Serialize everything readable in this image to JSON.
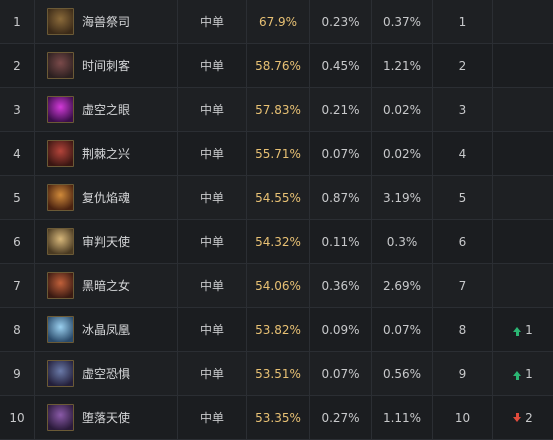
{
  "rows": [
    {
      "rank": "1",
      "hero": "海兽祭司",
      "position": "中单",
      "win_rate": "67.9%",
      "pick_rate": "0.23%",
      "ban_rate": "0.37%",
      "tier": "1",
      "trend": null,
      "avatar_color": [
        "#8a6a3a",
        "#3b2a18"
      ]
    },
    {
      "rank": "2",
      "hero": "时间刺客",
      "position": "中单",
      "win_rate": "58.76%",
      "pick_rate": "0.45%",
      "ban_rate": "1.21%",
      "tier": "2",
      "trend": null,
      "avatar_color": [
        "#7a4a4a",
        "#2c2020"
      ]
    },
    {
      "rank": "3",
      "hero": "虚空之眼",
      "position": "中单",
      "win_rate": "57.83%",
      "pick_rate": "0.21%",
      "ban_rate": "0.02%",
      "tier": "3",
      "trend": null,
      "avatar_color": [
        "#d23ad8",
        "#3a0e4a"
      ]
    },
    {
      "rank": "4",
      "hero": "荆棘之兴",
      "position": "中单",
      "win_rate": "55.71%",
      "pick_rate": "0.07%",
      "ban_rate": "0.02%",
      "tier": "4",
      "trend": null,
      "avatar_color": [
        "#b3443a",
        "#3a1612"
      ]
    },
    {
      "rank": "5",
      "hero": "复仇焰魂",
      "position": "中单",
      "win_rate": "54.55%",
      "pick_rate": "0.87%",
      "ban_rate": "3.19%",
      "tier": "5",
      "trend": null,
      "avatar_color": [
        "#d08a3a",
        "#4a2210"
      ]
    },
    {
      "rank": "6",
      "hero": "审判天使",
      "position": "中单",
      "win_rate": "54.32%",
      "pick_rate": "0.11%",
      "ban_rate": "0.3%",
      "tier": "6",
      "trend": null,
      "avatar_color": [
        "#d7b77a",
        "#4a3a22"
      ]
    },
    {
      "rank": "7",
      "hero": "黑暗之女",
      "position": "中单",
      "win_rate": "54.06%",
      "pick_rate": "0.36%",
      "ban_rate": "2.69%",
      "tier": "7",
      "trend": null,
      "avatar_color": [
        "#c0603a",
        "#3a1a12"
      ]
    },
    {
      "rank": "8",
      "hero": "冰晶凤凰",
      "position": "中单",
      "win_rate": "53.82%",
      "pick_rate": "0.09%",
      "ban_rate": "0.07%",
      "tier": "8",
      "trend": {
        "dir": "up",
        "value": "1"
      },
      "avatar_color": [
        "#9ad0ef",
        "#2a4a6a"
      ]
    },
    {
      "rank": "9",
      "hero": "虚空恐惧",
      "position": "中单",
      "win_rate": "53.51%",
      "pick_rate": "0.07%",
      "ban_rate": "0.56%",
      "tier": "9",
      "trend": {
        "dir": "up",
        "value": "1"
      },
      "avatar_color": [
        "#6a7aa8",
        "#231f3a"
      ]
    },
    {
      "rank": "10",
      "hero": "堕落天使",
      "position": "中单",
      "win_rate": "53.35%",
      "pick_rate": "0.27%",
      "ban_rate": "1.11%",
      "tier": "10",
      "trend": {
        "dir": "down",
        "value": "2"
      },
      "avatar_color": [
        "#8a5aa8",
        "#2a1a3a"
      ]
    }
  ]
}
